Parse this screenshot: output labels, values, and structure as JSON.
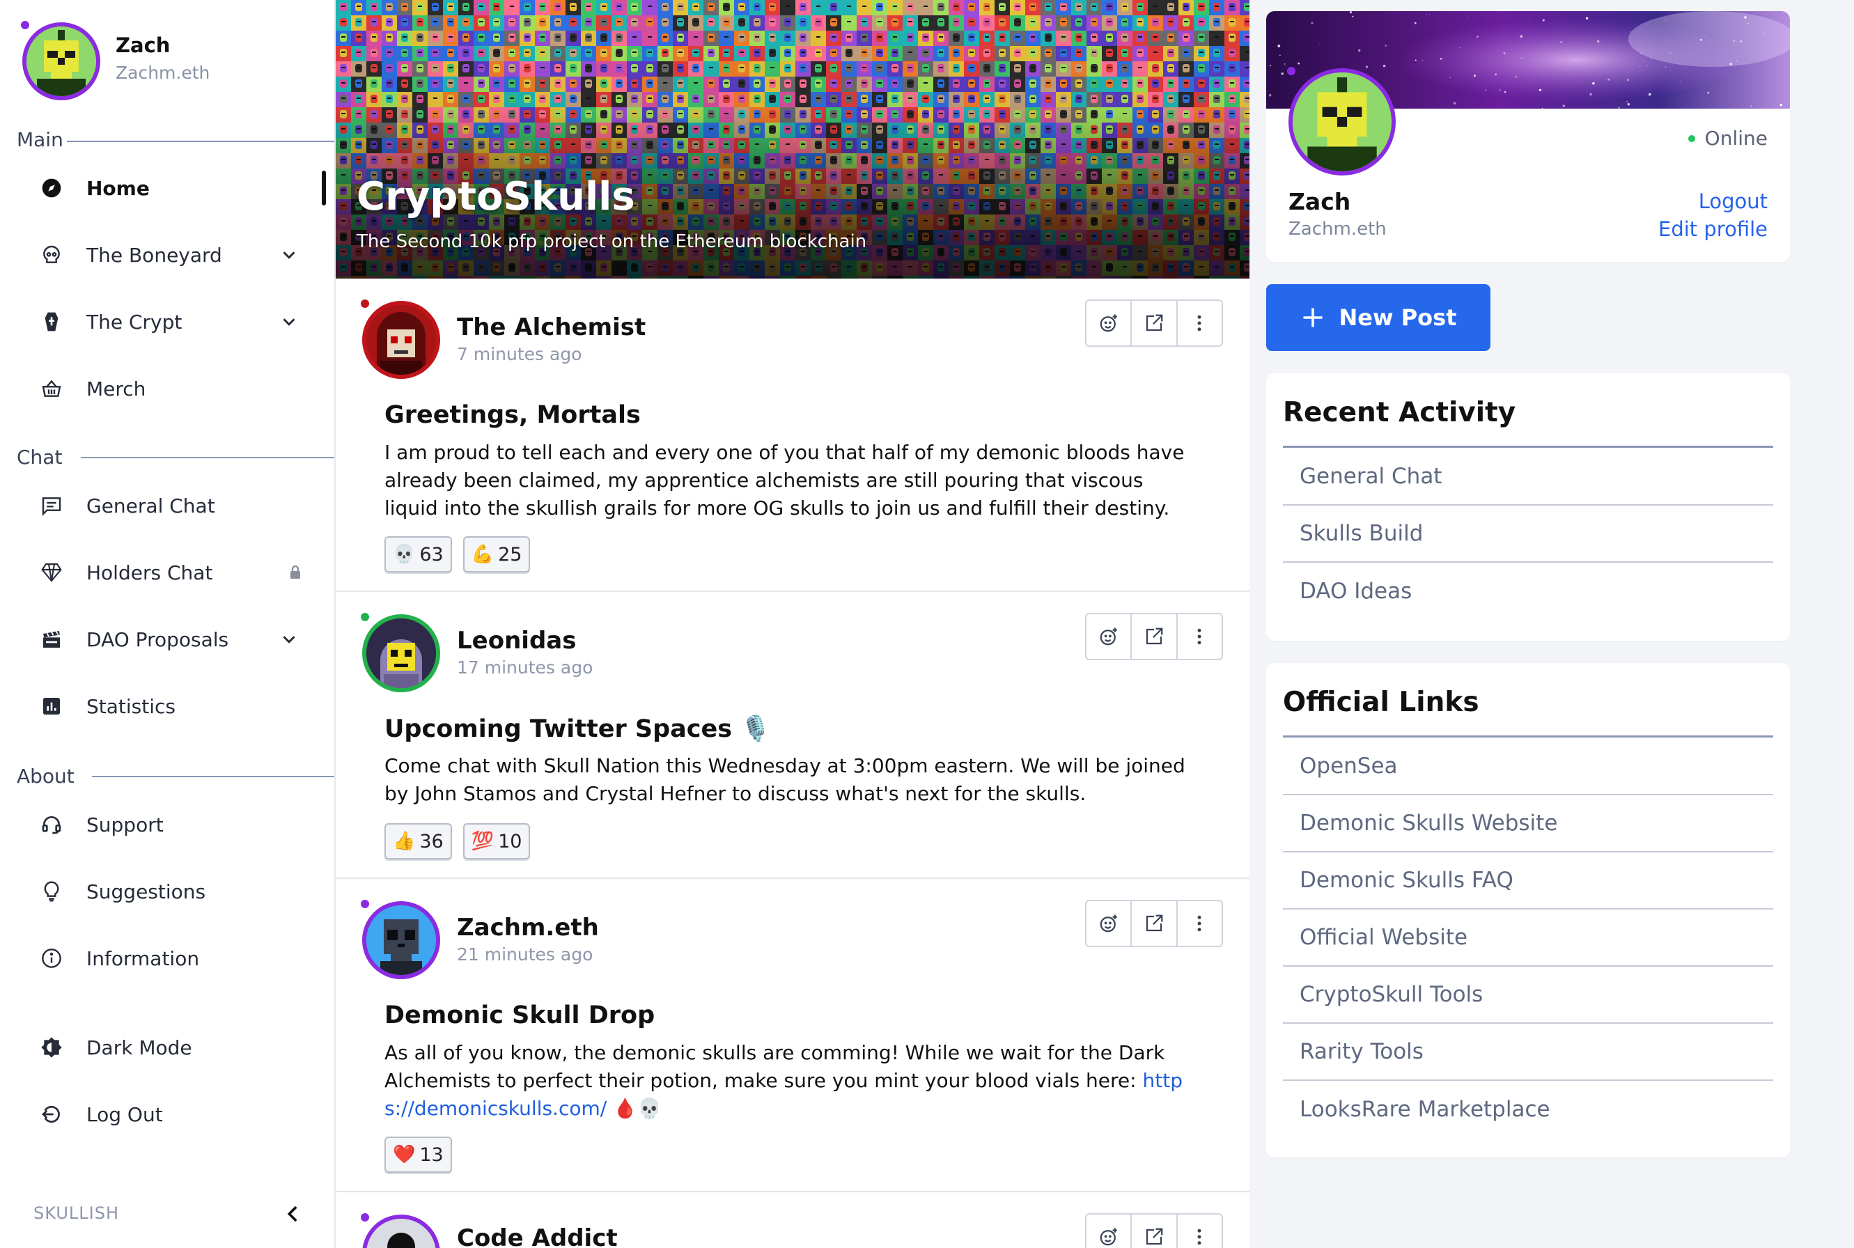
{
  "sidebar": {
    "user": {
      "name": "Zach",
      "handle": "Zachm.eth"
    },
    "sections": {
      "main": "Main",
      "chat": "Chat",
      "about": "About"
    },
    "items": [
      {
        "label": "Home",
        "icon": "compass-icon"
      },
      {
        "label": "The Boneyard",
        "icon": "skull-icon"
      },
      {
        "label": "The Crypt",
        "icon": "coffin-icon"
      },
      {
        "label": "Merch",
        "icon": "basket-icon"
      },
      {
        "label": "General Chat",
        "icon": "message-icon"
      },
      {
        "label": "Holders Chat",
        "icon": "diamond-icon"
      },
      {
        "label": "DAO Proposals",
        "icon": "clapperboard-icon"
      },
      {
        "label": "Statistics",
        "icon": "bar-chart-icon"
      },
      {
        "label": "Support",
        "icon": "headset-icon"
      },
      {
        "label": "Suggestions",
        "icon": "lightbulb-icon"
      },
      {
        "label": "Information",
        "icon": "info-icon"
      },
      {
        "label": "Dark Mode",
        "icon": "contrast-icon"
      },
      {
        "label": "Log Out",
        "icon": "logout-icon"
      }
    ],
    "footer": "SKULLISH"
  },
  "hero": {
    "title": "CryptoSkulls",
    "subtitle": "The Second 10k pfp project on the Ethereum blockchain"
  },
  "posts": [
    {
      "author": "The Alchemist",
      "time": "7 minutes ago",
      "title": "Greetings, Mortals",
      "body": "I am proud to tell each and every one of you that half of my demonic bloods have already been claimed, my apprentice alchemists are still pouring that viscous liquid into the skullish grails for more OG skulls to join us and fulfill their destiny.",
      "reactions": [
        {
          "emoji": "💀",
          "count": "63"
        },
        {
          "emoji": "💪",
          "count": "25"
        }
      ]
    },
    {
      "author": "Leonidas",
      "time": "17 minutes ago",
      "title": "Upcoming Twitter Spaces 🎙️",
      "body": "Come chat with Skull Nation this Wednesday at 3:00pm eastern. We will be joined by John Stamos and Crystal Hefner to discuss what's next for the skulls.",
      "reactions": [
        {
          "emoji": "👍",
          "count": "36"
        },
        {
          "emoji": "💯",
          "count": "10"
        }
      ]
    },
    {
      "author": "Zachm.eth",
      "time": "21 minutes ago",
      "title": "Demonic Skull Drop",
      "body": "As all of you know, the demonic skulls are comming! While we wait for the Dark Alchemists to perfect their potion, make sure you mint your blood vials here: ",
      "link": "https://demonicskulls.com/",
      "link_line1": "http",
      "link_line2": "s://demonicskulls.com/",
      "body_end": " 🩸💀",
      "reactions": [
        {
          "emoji": "❤️",
          "count": "13"
        }
      ]
    },
    {
      "author": "Code Addict"
    }
  ],
  "profile": {
    "name": "Zach",
    "handle": "Zachm.eth",
    "status": "Online",
    "logout": "Logout",
    "edit": "Edit profile"
  },
  "new_post_label": "New Post",
  "recent_activity": {
    "title": "Recent Activity",
    "items": [
      "General Chat",
      "Skulls Build",
      "DAO Ideas"
    ]
  },
  "official_links": {
    "title": "Official Links",
    "items": [
      "OpenSea",
      "Demonic Skulls Website",
      "Demonic Skulls FAQ",
      "Official Website",
      "CryptoSkull Tools",
      "Rarity Tools",
      "LooksRare Marketplace"
    ]
  },
  "colors": {
    "accent": "#2568ec",
    "online": "#22c55e",
    "ring": "#8a2be2"
  }
}
